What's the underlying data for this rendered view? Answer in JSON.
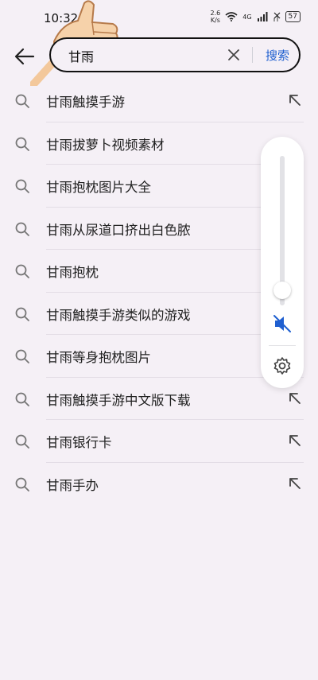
{
  "status_bar": {
    "time": "10:32",
    "net_speed_value": "2.6",
    "net_speed_unit": "K/s",
    "network": "4G",
    "battery": "57"
  },
  "search": {
    "query": "甘雨",
    "search_label": "搜索"
  },
  "suggestions": [
    {
      "text": "甘雨触摸手游"
    },
    {
      "text": "甘雨拔萝卜视频素材"
    },
    {
      "text": "甘雨抱枕图片大全"
    },
    {
      "text": "甘雨从尿道口挤出白色脓"
    },
    {
      "text": "甘雨抱枕"
    },
    {
      "text": "甘雨触摸手游类似的游戏"
    },
    {
      "text": "甘雨等身抱枕图片"
    },
    {
      "text": "甘雨触摸手游中文版下载"
    },
    {
      "text": "甘雨银行卡"
    },
    {
      "text": "甘雨手办"
    }
  ],
  "volume": {
    "level_fraction": 0.1,
    "muted": true
  },
  "colors": {
    "background": "#f5f0f6",
    "accent": "#1f5fd0",
    "mute_icon": "#1f5fd0"
  },
  "icons": {
    "thumb": "thumbs-up-icon",
    "back": "arrow-left-icon",
    "clear": "close-icon",
    "item": "search-icon",
    "fill": "arrow-up-left-icon",
    "mute": "speaker-muted-icon",
    "settings": "gear-icon"
  }
}
